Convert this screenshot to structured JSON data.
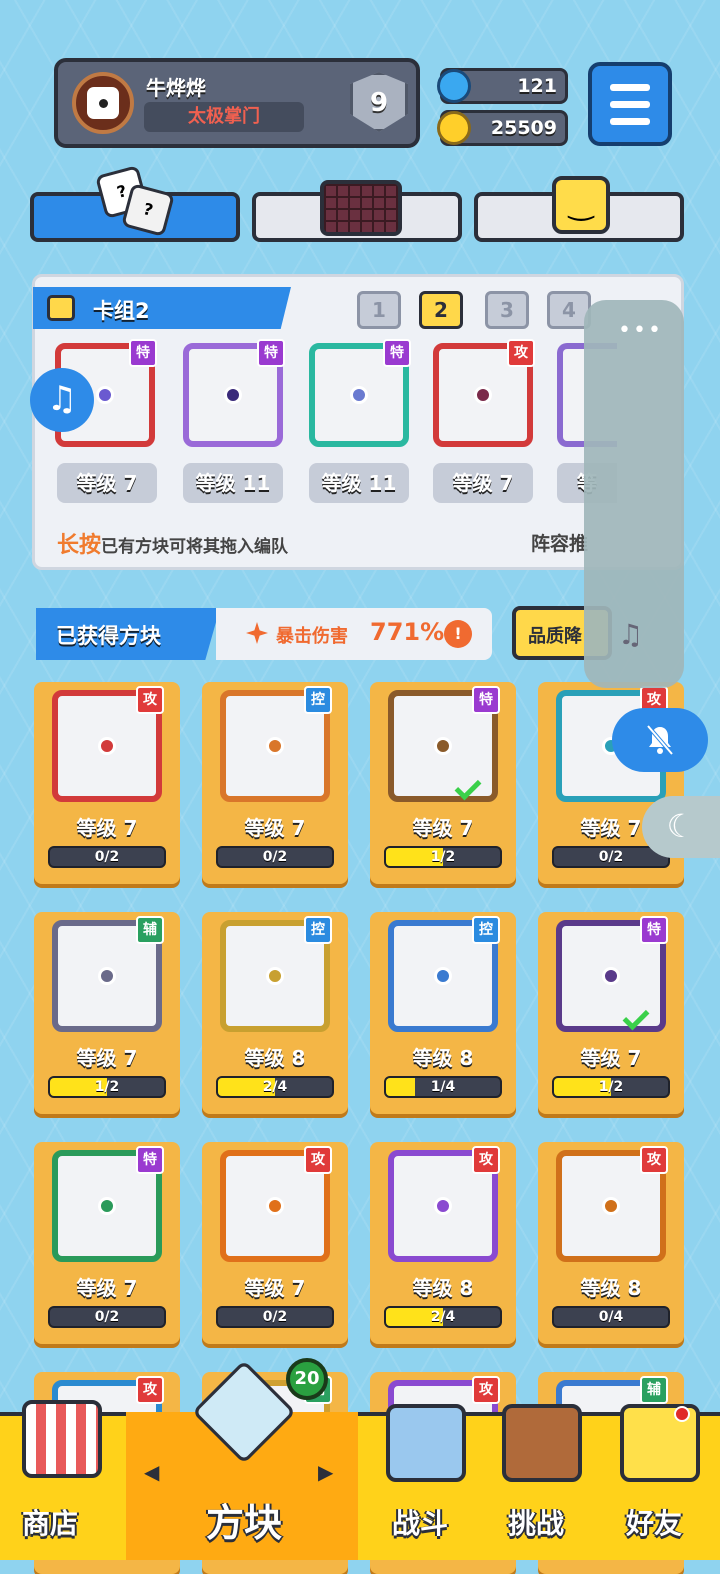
{
  "profile": {
    "name": "牛烨烨",
    "title": "太极掌门",
    "rank": "9"
  },
  "currency": {
    "gems": "121",
    "coins": "25509"
  },
  "tabs": [
    {
      "name": "dice"
    },
    {
      "name": "board"
    },
    {
      "name": "emoji"
    }
  ],
  "deck": {
    "title": "卡组2",
    "numbers": [
      "1",
      "2",
      "3",
      "4"
    ],
    "selected": "2",
    "cards": [
      {
        "tag": "特",
        "level": "等级 7"
      },
      {
        "tag": "特",
        "level": "等级 11"
      },
      {
        "tag": "特",
        "level": "等级 11"
      },
      {
        "tag": "攻",
        "level": "等级 7"
      },
      {
        "tag": "",
        "level": "等"
      }
    ],
    "hint_key": "长按",
    "hint_rest": "已有方块可将其拖入编队",
    "team": "阵容推"
  },
  "obtained": {
    "title": "已获得方块",
    "crit_label": "暴击伤害",
    "crit_value": "771%",
    "info": "!",
    "quality_btn": "品质降"
  },
  "blocks": [
    {
      "tag": "攻",
      "level": "等级 7",
      "progress": "0/2",
      "fill": 0,
      "color": "#d23a3a",
      "check": false
    },
    {
      "tag": "控",
      "level": "等级 7",
      "progress": "0/2",
      "fill": 0,
      "color": "#d9762a",
      "check": false
    },
    {
      "tag": "特",
      "level": "等级 7",
      "progress": "1/2",
      "fill": 0.5,
      "color": "#8a5a2a",
      "check": true
    },
    {
      "tag": "攻",
      "level": "等级 7",
      "progress": "0/2",
      "fill": 0,
      "color": "#2aa0b8",
      "check": false
    },
    {
      "tag": "辅",
      "level": "等级 7",
      "progress": "1/2",
      "fill": 0.5,
      "color": "#6a6a8a",
      "check": false
    },
    {
      "tag": "控",
      "level": "等级 8",
      "progress": "2/4",
      "fill": 0.5,
      "color": "#c8a030",
      "check": false
    },
    {
      "tag": "控",
      "level": "等级 8",
      "progress": "1/4",
      "fill": 0.25,
      "color": "#3a7ad0",
      "check": false
    },
    {
      "tag": "特",
      "level": "等级 7",
      "progress": "1/2",
      "fill": 0.5,
      "color": "#5a3a8a",
      "check": true
    },
    {
      "tag": "特",
      "level": "等级 7",
      "progress": "0/2",
      "fill": 0,
      "color": "#2a9a5a",
      "check": false
    },
    {
      "tag": "攻",
      "level": "等级 7",
      "progress": "0/2",
      "fill": 0,
      "color": "#e0701a",
      "check": false
    },
    {
      "tag": "攻",
      "level": "等级 8",
      "progress": "2/4",
      "fill": 0.5,
      "color": "#8a4ad0",
      "check": false
    },
    {
      "tag": "攻",
      "level": "等级 8",
      "progress": "0/4",
      "fill": 0,
      "color": "#d0701a",
      "check": false
    },
    {
      "tag": "攻",
      "level": "",
      "progress": "",
      "fill": 0,
      "color": "#2a8ad0",
      "check": false
    },
    {
      "tag": "辅",
      "level": "",
      "progress": "",
      "fill": 0,
      "color": "#d0a030",
      "check": false
    },
    {
      "tag": "攻",
      "level": "",
      "progress": "",
      "fill": 0,
      "color": "#8a4ad0",
      "check": false
    },
    {
      "tag": "辅",
      "level": "",
      "progress": "",
      "fill": 0,
      "color": "#3a7ad0",
      "check": false
    }
  ],
  "nav": {
    "shop": "商店",
    "blocks": "方块",
    "battle": "战斗",
    "challenge": "挑战",
    "friends": "好友",
    "badge": "20"
  },
  "icons": {
    "music": "♫",
    "note": "♫",
    "dots": "•••",
    "bell": "bell-off",
    "moon": "☾"
  }
}
